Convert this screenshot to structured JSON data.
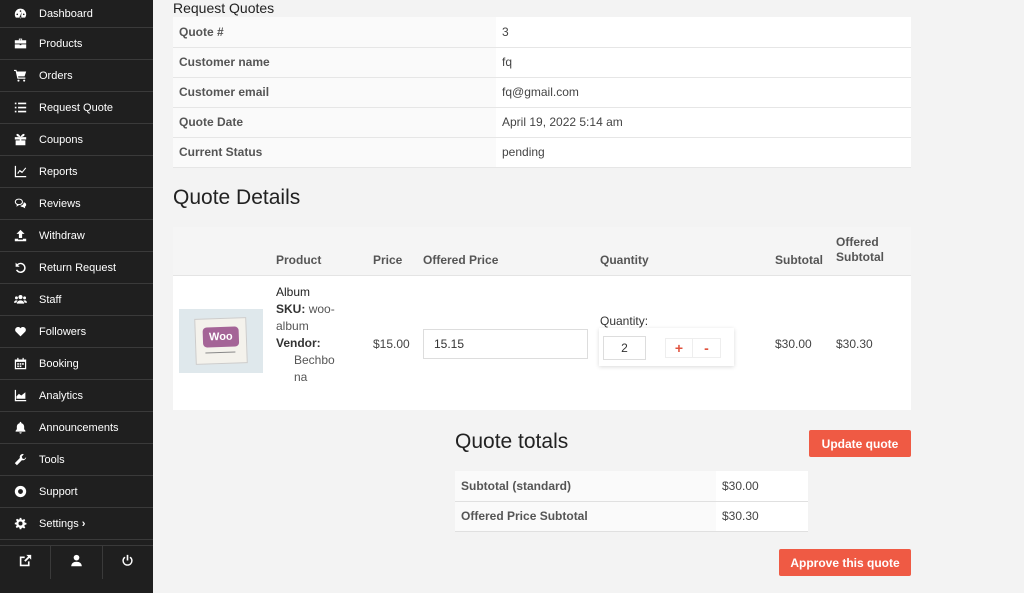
{
  "sidebar": {
    "items": [
      {
        "label": "Dashboard",
        "icon": "dashboard-icon"
      },
      {
        "label": "Products",
        "icon": "briefcase-icon"
      },
      {
        "label": "Orders",
        "icon": "cart-icon"
      },
      {
        "label": "Request Quote",
        "icon": "list-icon"
      },
      {
        "label": "Coupons",
        "icon": "gift-icon"
      },
      {
        "label": "Reports",
        "icon": "chart-icon"
      },
      {
        "label": "Reviews",
        "icon": "comments-icon"
      },
      {
        "label": "Withdraw",
        "icon": "upload-icon"
      },
      {
        "label": "Return Request",
        "icon": "undo-icon"
      },
      {
        "label": "Staff",
        "icon": "users-icon"
      },
      {
        "label": "Followers",
        "icon": "heart-icon"
      },
      {
        "label": "Booking",
        "icon": "calendar-icon"
      },
      {
        "label": "Analytics",
        "icon": "area-chart-icon"
      },
      {
        "label": "Announcements",
        "icon": "bell-icon"
      },
      {
        "label": "Tools",
        "icon": "wrench-icon"
      },
      {
        "label": "Support",
        "icon": "lifebuoy-icon"
      },
      {
        "label": "Settings",
        "icon": "gear-icon",
        "chevron": "›"
      }
    ],
    "footer_icons": [
      "external-link-icon",
      "user-icon",
      "power-icon"
    ]
  },
  "request_quotes": {
    "title": "Request Quotes",
    "rows": [
      {
        "label": "Quote #",
        "value": "3"
      },
      {
        "label": "Customer name",
        "value": "fq"
      },
      {
        "label": "Customer email",
        "value": "fq@gmail.com"
      },
      {
        "label": "Quote Date",
        "value": "April 19, 2022 5:14 am"
      },
      {
        "label": "Current Status",
        "value": "pending"
      }
    ]
  },
  "quote_details": {
    "title": "Quote Details",
    "headers": {
      "product": "Product",
      "price": "Price",
      "offered_price": "Offered Price",
      "quantity": "Quantity",
      "subtotal": "Subtotal",
      "offered_subtotal_line1": "Offered",
      "offered_subtotal_line2": "Subtotal"
    },
    "item": {
      "thumbnail_text": "Woo",
      "name": "Album",
      "sku_label": "SKU:",
      "sku_line1": "woo-",
      "sku_line2": "album",
      "vendor_label": "Vendor:",
      "vendor_line1": "Bechbo",
      "vendor_line2": "na",
      "price": "$15.00",
      "offered_price": "15.15",
      "quantity_label": "Quantity:",
      "quantity": "2",
      "plus": "+",
      "minus": "-",
      "subtotal": "$30.00",
      "offered_subtotal": "$30.30"
    }
  },
  "quote_totals": {
    "title": "Quote totals",
    "update_button": "Update quote",
    "approve_button": "Approve this quote",
    "rows": [
      {
        "label": "Subtotal (standard)",
        "value": "$30.00"
      },
      {
        "label": "Offered Price Subtotal",
        "value": "$30.30"
      }
    ]
  },
  "colors": {
    "accent": "#ef5a44",
    "sidebar_bg": "#1f1f1f"
  }
}
